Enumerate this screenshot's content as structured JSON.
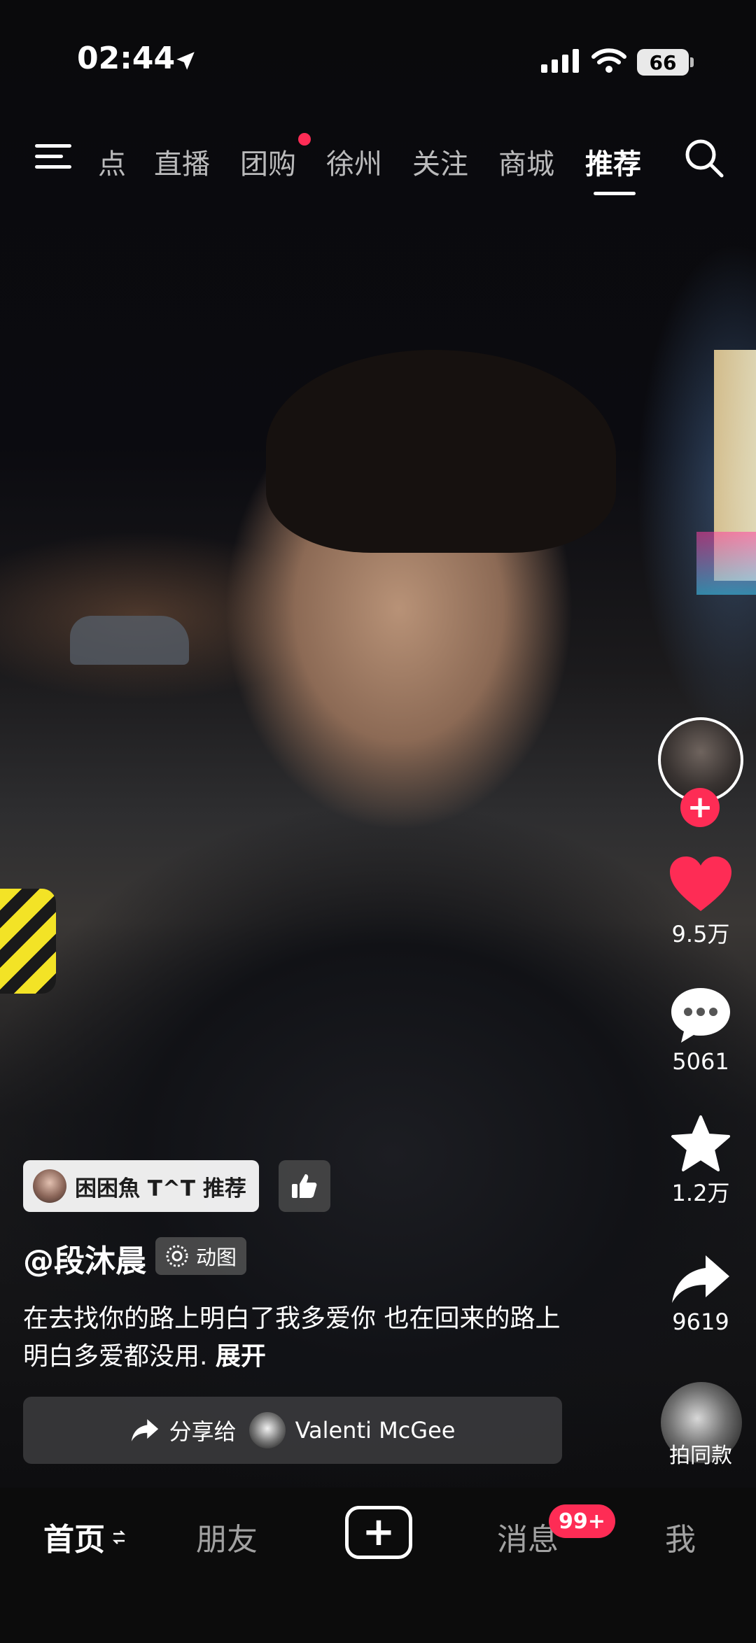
{
  "status_bar": {
    "time": "02:44",
    "battery": "66"
  },
  "top_tabs": [
    "点",
    "直播",
    "团购",
    "徐州",
    "关注",
    "商城",
    "推荐"
  ],
  "active_tab": "推荐",
  "actions": {
    "likes": "9.5万",
    "comments": "5061",
    "favorites": "1.2万",
    "shares": "9619",
    "sound_label": "拍同款"
  },
  "post": {
    "recommender": "困困魚 T^T 推荐",
    "author": "@段沐晨",
    "tag": "动图",
    "caption": "在去找你的路上明白了我多爱你 也在回来的路上明白多爱都没用.",
    "expand": "展开",
    "share_label": "分享给",
    "share_user": "Valenti McGee"
  },
  "bottom_nav": {
    "home": "首页",
    "friends": "朋友",
    "messages": "消息",
    "messages_badge": "99+",
    "me": "我"
  }
}
